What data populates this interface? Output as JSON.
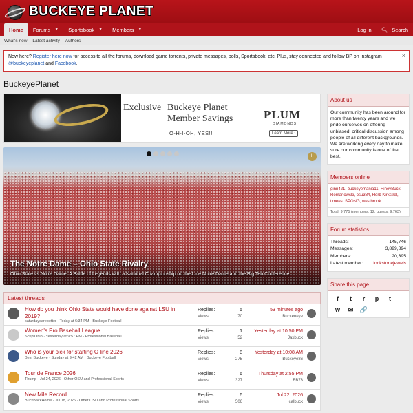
{
  "brand": {
    "name": "BUCKEYE PLANET"
  },
  "nav": {
    "tabs": [
      {
        "label": "Home"
      },
      {
        "label": "Forums"
      },
      {
        "label": "Sportsbook"
      },
      {
        "label": "Members"
      }
    ],
    "login": "Log in",
    "search": "Search"
  },
  "subnav": {
    "items": [
      "What's new",
      "Latest activity",
      "Authors"
    ]
  },
  "notice": {
    "prefix": "New here? ",
    "register_link": "Register here now",
    "body": " for access to all the forums, download game torrents, private messages, polls, Sportsbook, etc. Plus, stay connected and follow BP on Instagram ",
    "instagram": "@buckeyeplanet",
    "and": " and ",
    "facebook": "Facebook",
    "end": ".",
    "close": "×"
  },
  "page_title": "BuckeyePlanet",
  "ad": {
    "exclusive": "Exclusive",
    "line1": "Buckeye Planet",
    "line2": "Member Savings",
    "tagline": "O-H-I-OH, YES!!",
    "plum": "PLUM",
    "diamonds": "DIAMONDS",
    "learn": "Learn More ›"
  },
  "hero": {
    "title": "The Notre Dame – Ohio State Rivalry",
    "desc": "Ohio State vs Notre Dame: A Battle of Legends with a National Championship on the Line Notre Dame and the Big Ten Conference",
    "slide_index": 1,
    "slide_count": 5,
    "pause": "II"
  },
  "latest": {
    "header": "Latest threads",
    "replies_label": "Replies:",
    "views_label": "Views:",
    "threads": [
      {
        "title": "How do you think Ohio State would have done against LSU in 2019?",
        "meta": "saturdaysarebetter · Today at 6:34 PM · Buckeye Football",
        "replies": "5",
        "views": "70",
        "last_time": "53 minutes ago",
        "last_user": "Buckeneye"
      },
      {
        "title": "Women's Pro Baseball League",
        "meta": "ScriptOhio · Yesterday at 9:57 PM · Professional Baseball",
        "replies": "1",
        "views": "52",
        "last_time": "Yesterday at 10:50 PM",
        "last_user": "Jaxbuck"
      },
      {
        "title": "Who is your pick for starting O line 2026",
        "meta": "Best Buckeye · Sunday at 9:42 AM · Buckeye Football",
        "replies": "8",
        "views": "275",
        "last_time": "Yesterday at 10:08 AM",
        "last_user": "Buckeye86"
      },
      {
        "title": "Tour de France 2026",
        "meta": "Thump · Jul 24, 2026 · Other OSU and Professional Sports",
        "replies": "6",
        "views": "327",
        "last_time": "Thursday at 2:55 PM",
        "last_user": "BB73"
      },
      {
        "title": "New Mile Record",
        "meta": "BuckBackHome · Jul 18, 2026 · Other OSU and Professional Sports",
        "replies": "6",
        "views": "506",
        "last_time": "Jul 22, 2026",
        "last_user": "calbuck"
      }
    ]
  },
  "sidebar": {
    "about": {
      "header": "About us",
      "body": "Our community has been around for more than twenty years and we pride ourselves on offering unbiased, critical discussion among people of all different backgrounds. We are working every day to make sure our community is one of the best."
    },
    "online": {
      "header": "Members online",
      "names": "ginn421, buckeyemania11, HineyBuck, Romanowski, osu384, Herb Kirkstrel, timees, SPONG, westbrook",
      "total": "Total: 9,775 (members: 12, guests: 9,763)"
    },
    "stats": {
      "header": "Forum statistics",
      "rows": [
        {
          "label": "Threads:",
          "value": "145,746"
        },
        {
          "label": "Messages:",
          "value": "3,899,894"
        },
        {
          "label": "Members:",
          "value": "20,395"
        },
        {
          "label": "Latest member:",
          "value": "lockstonejewels"
        }
      ]
    },
    "share": {
      "header": "Share this page",
      "icons": [
        "f",
        "t",
        "r",
        "p",
        "t",
        "w",
        "✉",
        "🔗"
      ]
    }
  }
}
